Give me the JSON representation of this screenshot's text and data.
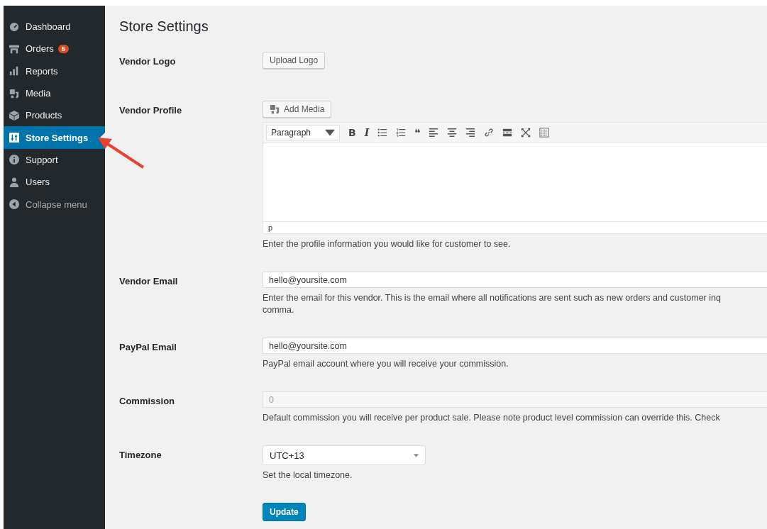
{
  "sidebar": {
    "items": [
      {
        "label": "Dashboard",
        "selected": false
      },
      {
        "label": "Orders",
        "selected": false,
        "badge": "5"
      },
      {
        "label": "Reports",
        "selected": false
      },
      {
        "label": "Media",
        "selected": false
      },
      {
        "label": "Products",
        "selected": false
      },
      {
        "label": "Store Settings",
        "selected": true
      },
      {
        "label": "Support",
        "selected": false
      },
      {
        "label": "Users",
        "selected": false
      },
      {
        "label": "Collapse menu",
        "selected": false,
        "kind": "collapse"
      }
    ]
  },
  "page": {
    "title": "Store Settings"
  },
  "fields": [
    {
      "kind": "upload",
      "label": "Vendor Logo",
      "button": "Upload Logo"
    },
    {
      "kind": "editor",
      "label": "Vendor Profile",
      "button": "Add Media",
      "format": "Paragraph",
      "toolbar": [
        {
          "kind": "glyph",
          "label": "B"
        },
        {
          "kind": "glyph-italic",
          "label": "I"
        },
        {
          "kind": "bullet-list"
        },
        {
          "kind": "number-list"
        },
        {
          "kind": "glyph",
          "label": "❝"
        },
        {
          "kind": "align-left"
        },
        {
          "kind": "align-center"
        },
        {
          "kind": "align-right"
        },
        {
          "kind": "link"
        },
        {
          "kind": "more"
        },
        {
          "kind": "fullscreen"
        },
        {
          "kind": "keyboard"
        }
      ],
      "path": "p",
      "description": [
        "Enter the profile information you would like for customer to see."
      ]
    },
    {
      "kind": "text",
      "label": "Vendor Email",
      "value": "hello@yoursite.com",
      "disabled": false,
      "description": [
        "Enter the email for this vendor. This is the email where all notifications are sent such as new orders and customer inq",
        "comma."
      ]
    },
    {
      "kind": "text",
      "label": "PayPal Email",
      "value": "hello@yoursite.com",
      "disabled": false,
      "description": [
        "PayPal email account where you will receive your commission."
      ]
    },
    {
      "kind": "text",
      "label": "Commission",
      "value": "0",
      "disabled": true,
      "description": [
        "Default commission you will receive per product sale. Please note product level commission can override this. Check"
      ]
    },
    {
      "kind": "select",
      "label": "Timezone",
      "value": "UTC+13",
      "description": [
        "Set the local timezone."
      ]
    }
  ],
  "submit": "Update"
}
